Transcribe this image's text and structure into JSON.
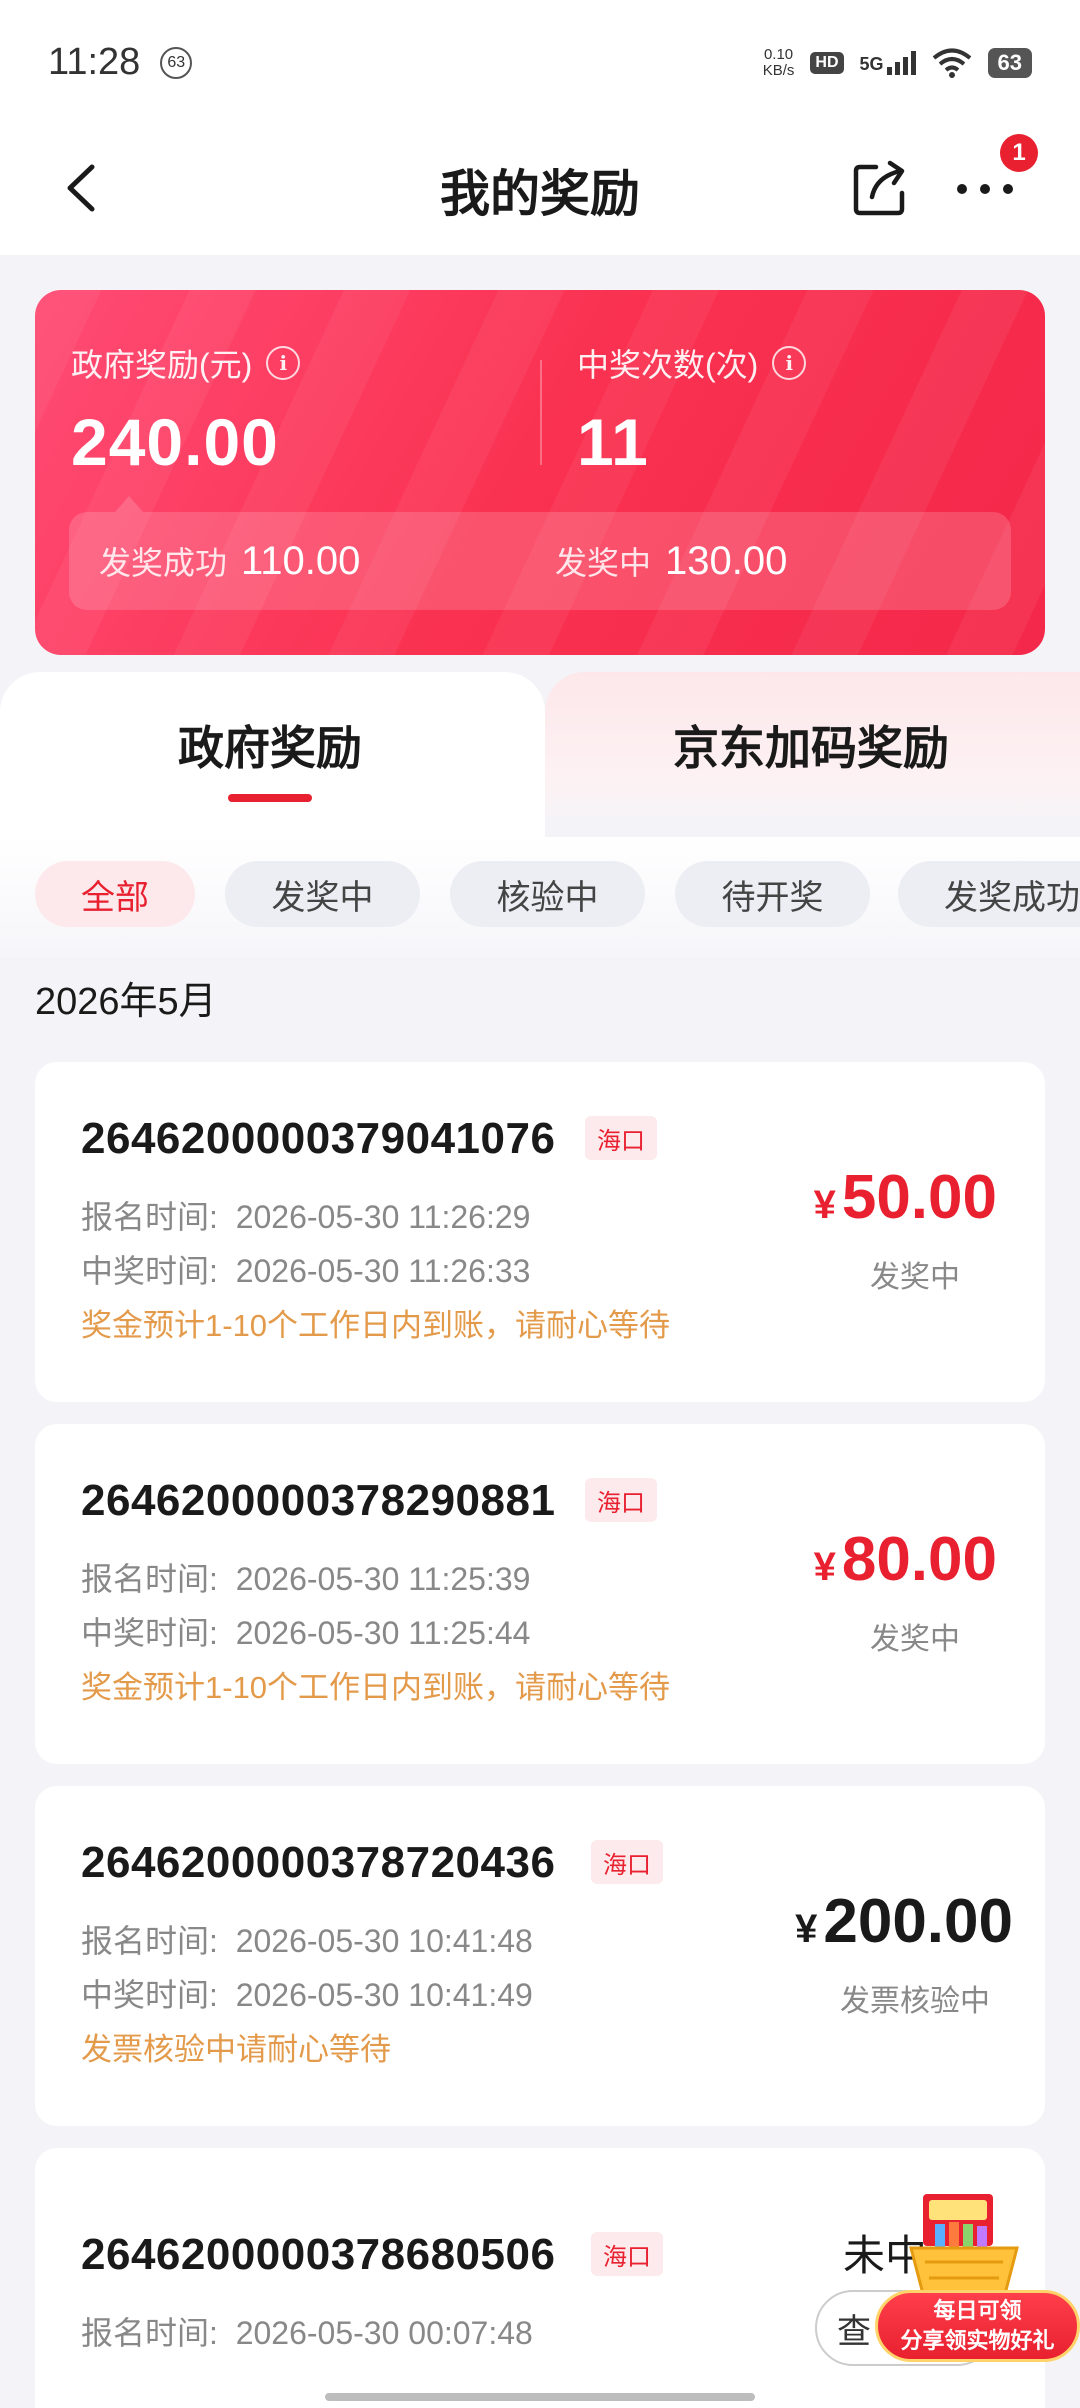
{
  "status_bar": {
    "time": "11:28",
    "notif_count": "63",
    "net_speed_value": "0.10",
    "net_speed_unit": "KB/s",
    "hd": "HD",
    "network": "5G",
    "battery": "63"
  },
  "header": {
    "title": "我的奖励",
    "badge_count": "1"
  },
  "summary": {
    "gov_reward_label": "政府奖励(元)",
    "gov_reward_value": "240.00",
    "win_count_label": "中奖次数(次)",
    "win_count_value": "11",
    "paid_label": "发奖成功",
    "paid_value": "110.00",
    "paying_label": "发奖中",
    "paying_value": "130.00"
  },
  "tabs": {
    "gov": "政府奖励",
    "jd": "京东加码奖励"
  },
  "filters": [
    "全部",
    "发奖中",
    "核验中",
    "待开奖",
    "发奖成功"
  ],
  "month": "2026年5月",
  "labels": {
    "signup_prefix": "报名时间:",
    "win_prefix": "中奖时间:",
    "yen": "¥"
  },
  "records": [
    {
      "id": "2646200000379041076",
      "tag": "海口",
      "signup_time": "2026-05-30 11:26:29",
      "win_time": "2026-05-30 11:26:33",
      "note": "奖金预计1-10个工作日内到账，请耐心等待",
      "amount": "50.00",
      "status": "发奖中"
    },
    {
      "id": "2646200000378290881",
      "tag": "海口",
      "signup_time": "2026-05-30 11:25:39",
      "win_time": "2026-05-30 11:25:44",
      "note": "奖金预计1-10个工作日内到账，请耐心等待",
      "amount": "80.00",
      "status": "发奖中"
    },
    {
      "id": "2646200000378720436",
      "tag": "海口",
      "signup_time": "2026-05-30 10:41:48",
      "win_time": "2026-05-30 10:41:49",
      "note": "发票核验中请耐心等待",
      "amount": "200.00",
      "status": "发票核验中"
    },
    {
      "id": "2646200000378680506",
      "tag": "海口",
      "signup_time": "2026-05-30 00:07:48",
      "status": "未中",
      "action": "查"
    }
  ],
  "promo": {
    "line1": "每日可领",
    "line2": "分享领实物好礼"
  }
}
